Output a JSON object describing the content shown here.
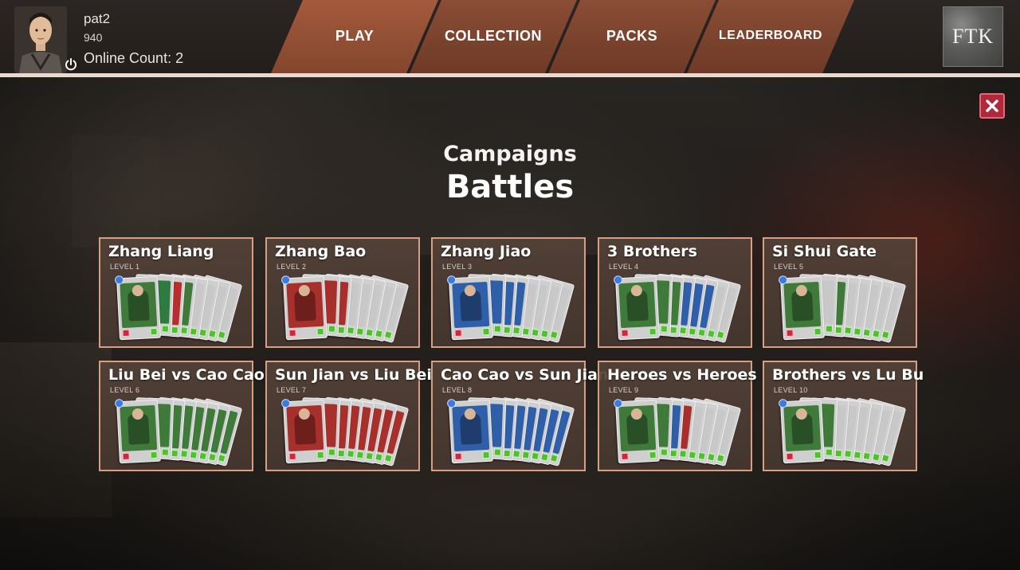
{
  "player": {
    "username": "pat2",
    "score": "940",
    "online_count": "Online Count: 2"
  },
  "nav": {
    "tabs": [
      {
        "label": "PLAY",
        "active": true
      },
      {
        "label": "COLLECTION",
        "active": false
      },
      {
        "label": "PACKS",
        "active": false
      },
      {
        "label": "LEADERBOARD",
        "active": false
      }
    ]
  },
  "logo": {
    "text": "FTK"
  },
  "heading": {
    "subtitle": "Campaigns",
    "title": "Battles"
  },
  "icons": {
    "power": "power-icon",
    "close": "close-icon"
  },
  "colors": {
    "accent_tab": "#8a4d35",
    "tile_border": "#d79e82",
    "close_button": "#b0283a"
  },
  "battles": [
    {
      "title": "Zhang Liang",
      "level": "LEVEL 1",
      "deck": [
        "#3f7a3b",
        "#2f7a40",
        "#b82e2e",
        "#3f7a3b",
        "#c8c8c8",
        "#c8c8c8",
        "#c8c8c8",
        "#c8c8c8"
      ]
    },
    {
      "title": "Zhang Bao",
      "level": "LEVEL 2",
      "deck": [
        "#a8302c",
        "#a8302c",
        "#a8302c",
        "#c8c8c8",
        "#c8c8c8",
        "#c8c8c8",
        "#c8c8c8",
        "#c8c8c8"
      ]
    },
    {
      "title": "Zhang Jiao",
      "level": "LEVEL 3",
      "deck": [
        "#2e5fa8",
        "#2e5fa8",
        "#2e5fa8",
        "#2e5fa8",
        "#c8c8c8",
        "#c8c8c8",
        "#c8c8c8",
        "#c8c8c8"
      ]
    },
    {
      "title": "3 Brothers",
      "level": "LEVEL 4",
      "deck": [
        "#3f7a3b",
        "#3f7a3b",
        "#3f7a3b",
        "#2e5fa8",
        "#2e5fa8",
        "#2e5fa8",
        "#c8c8c8",
        "#c8c8c8"
      ]
    },
    {
      "title": "Si Shui Gate",
      "level": "LEVEL 5",
      "deck": [
        "#3f7a3b",
        "#c8c8c8",
        "#3f7a3b",
        "#c8c8c8",
        "#c8c8c8",
        "#c8c8c8",
        "#c8c8c8",
        "#c8c8c8"
      ]
    },
    {
      "title": "Liu Bei vs Cao Cao",
      "level": "LEVEL 6",
      "deck": [
        "#3f7a3b",
        "#3f7a3b",
        "#3f7a3b",
        "#3f7a3b",
        "#3f7a3b",
        "#3f7a3b",
        "#3f7a3b",
        "#3f7a3b"
      ]
    },
    {
      "title": "Sun Jian vs Liu Bei",
      "level": "LEVEL 7",
      "deck": [
        "#a8302c",
        "#a8302c",
        "#a8302c",
        "#a8302c",
        "#a8302c",
        "#a8302c",
        "#a8302c",
        "#a8302c"
      ]
    },
    {
      "title": "Cao Cao vs Sun Jian",
      "level": "LEVEL 8",
      "deck": [
        "#2e5fa8",
        "#2e5fa8",
        "#2e5fa8",
        "#2e5fa8",
        "#2e5fa8",
        "#2e5fa8",
        "#2e5fa8",
        "#2e5fa8"
      ]
    },
    {
      "title": "Heroes vs Heroes",
      "level": "LEVEL 9",
      "deck": [
        "#3f7a3b",
        "#3f7a3b",
        "#2e5fa8",
        "#a8302c",
        "#c8c8c8",
        "#c8c8c8",
        "#c8c8c8",
        "#c8c8c8"
      ]
    },
    {
      "title": "Brothers vs Lu Bu",
      "level": "LEVEL 10",
      "deck": [
        "#3f7a3b",
        "#3f7a3b",
        "#c8c8c8",
        "#c8c8c8",
        "#c8c8c8",
        "#c8c8c8",
        "#c8c8c8",
        "#c8c8c8"
      ]
    }
  ]
}
